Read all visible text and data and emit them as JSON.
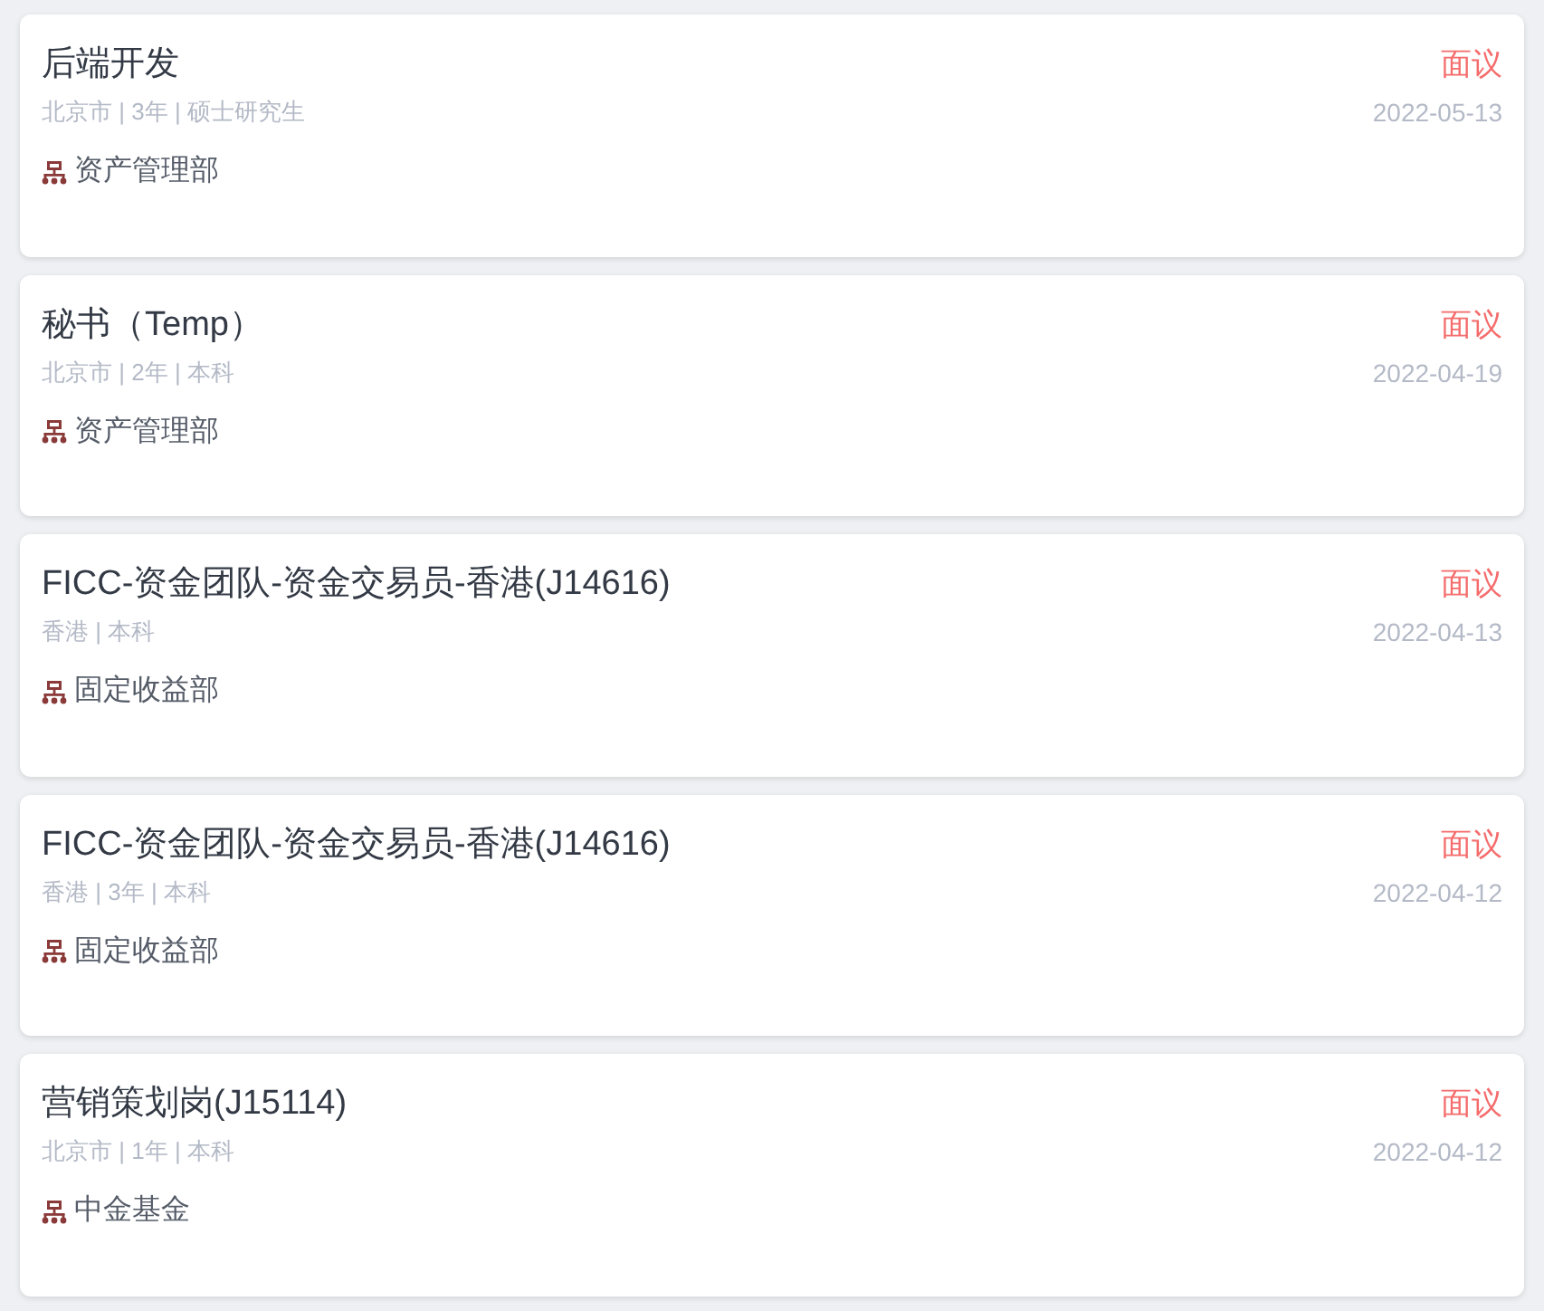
{
  "jobs": [
    {
      "title": "后端开发",
      "meta": "北京市 | 3年 | 硕士研究生",
      "department": "资产管理部",
      "salary": "面议",
      "date": "2022-05-13"
    },
    {
      "title": "秘书（Temp）",
      "meta": "北京市 | 2年 | 本科",
      "department": "资产管理部",
      "salary": "面议",
      "date": "2022-04-19"
    },
    {
      "title": "FICC-资金团队-资金交易员-香港(J14616)",
      "meta": "香港 | 本科",
      "department": "固定收益部",
      "salary": "面议",
      "date": "2022-04-13"
    },
    {
      "title": "FICC-资金团队-资金交易员-香港(J14616)",
      "meta": "香港 | 3年 | 本科",
      "department": "固定收益部",
      "salary": "面议",
      "date": "2022-04-12"
    },
    {
      "title": "营销策划岗(J15114)",
      "meta": "北京市 | 1年 | 本科",
      "department": "中金基金",
      "salary": "面议",
      "date": "2022-04-12"
    }
  ]
}
